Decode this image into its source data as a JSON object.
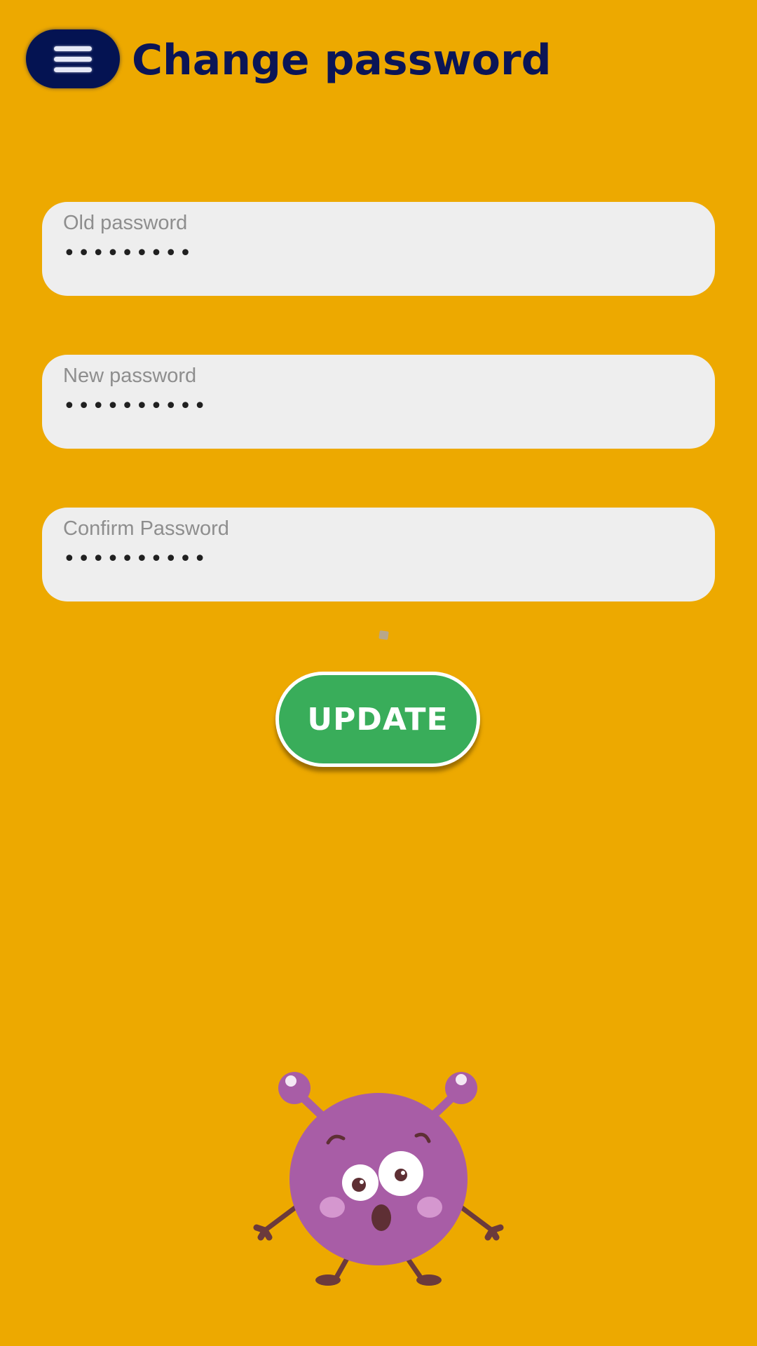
{
  "header": {
    "menu_icon": "hamburger-menu-icon",
    "title": "Change password"
  },
  "form": {
    "old_password": {
      "label": "Old password",
      "value": "•••••••••"
    },
    "new_password": {
      "label": "New password",
      "value": "••••••••••"
    },
    "confirm_password": {
      "label": "Confirm Password",
      "value": "••••••••••"
    }
  },
  "actions": {
    "update_label": "UPDATE"
  },
  "illustration": {
    "icon": "purple-monster-mascot"
  },
  "colors": {
    "background": "#EDA900",
    "menu_button": "#041352",
    "title": "#0B1556",
    "field_bg": "#EEEEEE",
    "update_button": "#39AD5A",
    "monster": "#A85DA6"
  }
}
